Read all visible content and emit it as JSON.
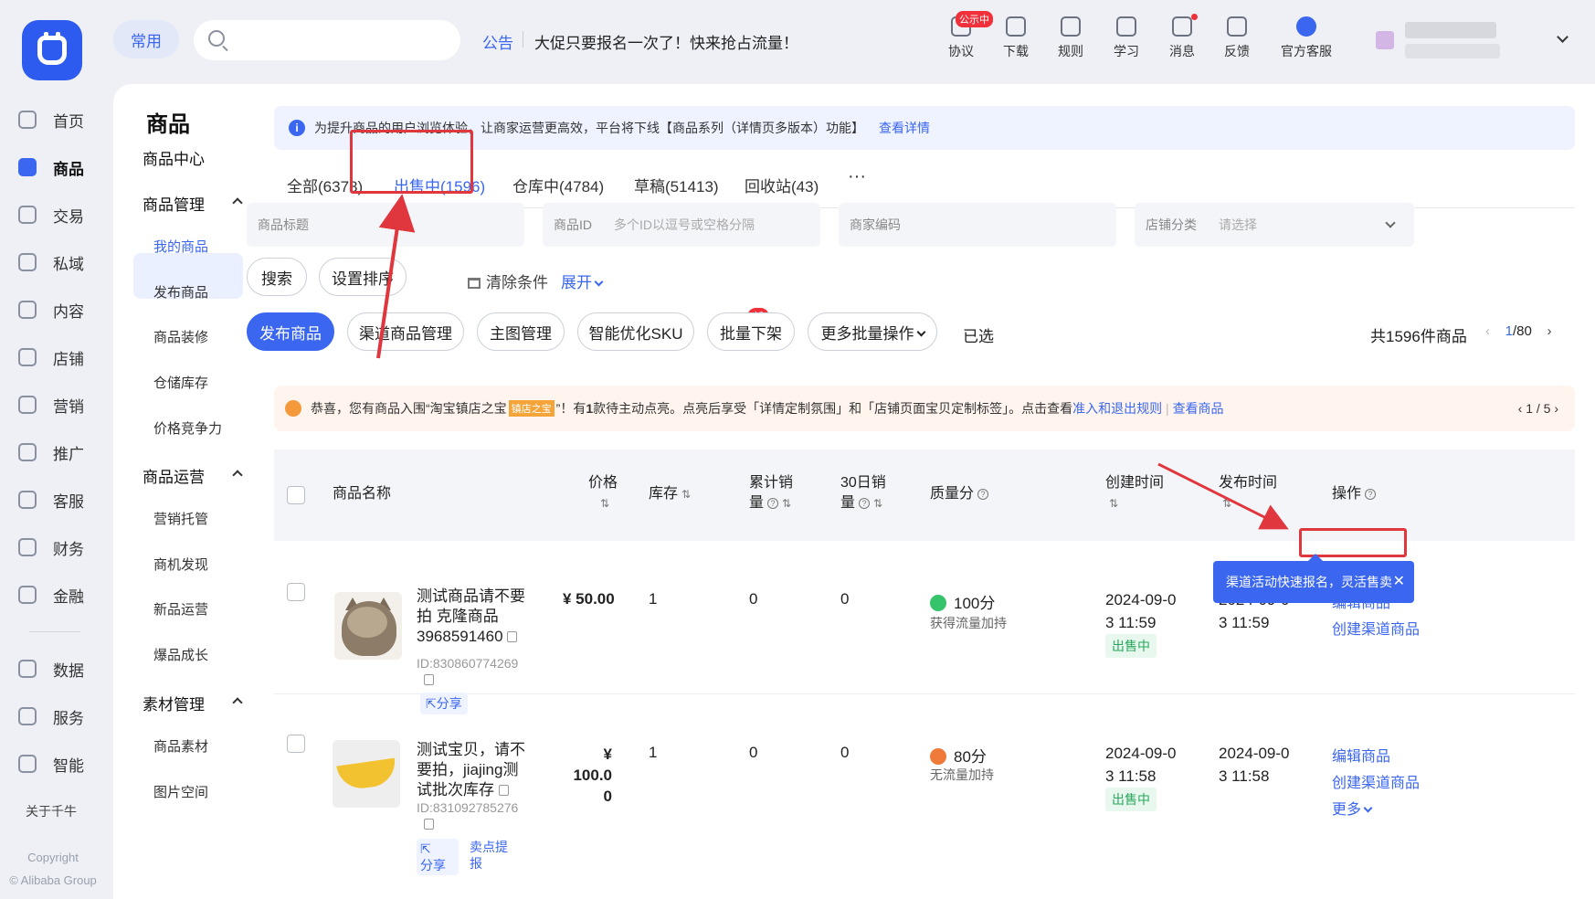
{
  "topbar": {
    "common_label": "常用",
    "search_placeholder": "",
    "notice_label": "公告",
    "notice_text": "大促只要报名一次了！快来抢占流量！",
    "tools": [
      {
        "label": "协议",
        "icon": "document-icon",
        "badge": "公示中"
      },
      {
        "label": "下载",
        "icon": "download-icon"
      },
      {
        "label": "规则",
        "icon": "rules-icon"
      },
      {
        "label": "学习",
        "icon": "learn-icon"
      },
      {
        "label": "消息",
        "icon": "message-icon"
      },
      {
        "label": "反馈",
        "icon": "feedback-icon"
      },
      {
        "label": "官方客服",
        "icon": "customer-service-icon"
      }
    ]
  },
  "rail": {
    "items": [
      {
        "label": "首页",
        "icon": "home-icon"
      },
      {
        "label": "商品",
        "icon": "product-icon",
        "active": true
      },
      {
        "label": "交易",
        "icon": "trade-icon"
      },
      {
        "label": "私域",
        "icon": "private-domain-icon"
      },
      {
        "label": "内容",
        "icon": "content-icon"
      },
      {
        "label": "店铺",
        "icon": "store-icon"
      },
      {
        "label": "营销",
        "icon": "marketing-icon"
      },
      {
        "label": "推广",
        "icon": "promotion-icon"
      },
      {
        "label": "客服",
        "icon": "headset-icon"
      },
      {
        "label": "财务",
        "icon": "finance-icon"
      },
      {
        "label": "金融",
        "icon": "bank-icon"
      },
      {
        "label": "数据",
        "icon": "data-icon"
      },
      {
        "label": "服务",
        "icon": "service-icon"
      },
      {
        "label": "智能",
        "icon": "smart-icon"
      }
    ],
    "about": "关于千牛",
    "copyright_1": "Copyright",
    "copyright_2": "© Alibaba Group"
  },
  "subnav": {
    "title": "商品",
    "center": "商品中心",
    "group_manage": "商品管理",
    "manage_items": [
      "我的商品",
      "发布商品",
      "商品装修",
      "仓储库存",
      "价格竞争力"
    ],
    "group_ops": "商品运营",
    "ops_items": [
      "营销托管",
      "商机发现",
      "新品运营",
      "爆品成长"
    ],
    "group_material": "素材管理",
    "material_items": [
      "商品素材",
      "图片空间"
    ]
  },
  "main": {
    "info_text": "为提升商品的用户浏览体验，让商家运营更高效，平台将下线【商品系列（详情页多版本）功能】",
    "info_link": "查看详情",
    "tabs": [
      "全部(6378)",
      "出售中(1596)",
      "仓库中(4784)",
      "草稿(51413)",
      "回收站(43)"
    ],
    "tab_more": "···",
    "filters": {
      "title_label": "商品标题",
      "id_label": "商品ID",
      "id_placeholder": "多个ID以逗号或空格分隔",
      "code_label": "商家编码",
      "category_label": "店铺分类",
      "category_placeholder": "请选择"
    },
    "search_btn": "搜索",
    "sort_btn": "设置排序",
    "clear_btn": "清除条件",
    "expand_btn": "展开",
    "actions": [
      "发布商品",
      "渠道商品管理",
      "主图管理",
      "智能优化SKU",
      "批量下架",
      "更多批量操作"
    ],
    "new_badge": "新",
    "selected": "已选",
    "total": "共1596件商品",
    "page_current": "1",
    "page_total": "/80",
    "promo": {
      "p1": "恭喜，您有商品入围“淘宝镇店之宝",
      "tag": "镇店之宝",
      "p2": "”！有",
      "count": "1",
      "p3": "款待主动点亮。点亮后享受「详情定制氛围」和「店铺页面宝贝定制标签」。点击查看",
      "link1": "准入和退出规则",
      "sep": "|",
      "link2": "查看商品",
      "pager": "‹ 1 / 5 ›"
    },
    "columns": {
      "name": "商品名称",
      "price": "价格",
      "stock": "库存",
      "total_sales_1": "累计销",
      "total_sales_2": "量",
      "sales30_1": "30日销",
      "sales30_2": "量",
      "quality": "质量分",
      "created": "创建时间",
      "published": "发布时间",
      "ops": "操作"
    },
    "rows": [
      {
        "name": "测试商品请不要拍 克隆商品 3968591460",
        "id": "ID:830860774269",
        "share": "分享",
        "price": "¥ 50.00",
        "stock": "1",
        "total_sales": "0",
        "sales30": "0",
        "score": "100分",
        "score_note": "获得流量加持",
        "created_1": "2024-09-0",
        "created_2": "3 11:59",
        "published_1": "2024-09-0",
        "published_2": "3 11:59",
        "status": "出售中",
        "op_edit": "编辑商品",
        "op_channel": "创建渠道商品"
      },
      {
        "name": "测试宝贝，请不要拍，jiajing测试批次库存",
        "id": "ID:831092785276",
        "share": "分享",
        "highlight": "卖点提报",
        "price_1": "¥ 100.0",
        "price_2": "0",
        "stock": "1",
        "total_sales": "0",
        "sales30": "0",
        "score": "80分",
        "score_note": "无流量加持",
        "created_1": "2024-09-0",
        "created_2": "3 11:58",
        "published_1": "2024-09-0",
        "published_2": "3 11:58",
        "status": "出售中",
        "op_edit": "编辑商品",
        "op_channel": "创建渠道商品",
        "op_more": "更多"
      }
    ],
    "tooltip": "渠道活动快速报名，灵活售卖",
    "tooltip_close": "✕"
  },
  "annotation_color": "#e0363e"
}
